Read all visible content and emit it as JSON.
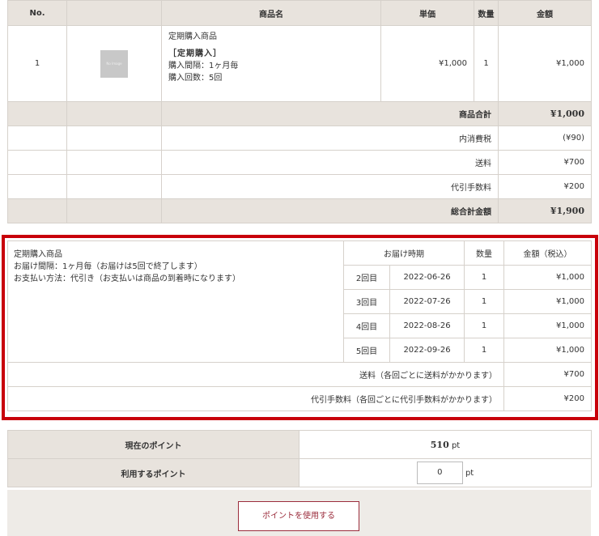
{
  "order": {
    "headers": {
      "no": "No.",
      "blank": "",
      "name": "商品名",
      "unit_price": "単価",
      "qty": "数量",
      "amount": "金額"
    },
    "item": {
      "no": "1",
      "image_text": "No Image",
      "name": "定期購入商品",
      "tag": "［定期購入］",
      "interval": "購入間隔：1ヶ月毎",
      "count": "購入回数：5回",
      "unit_price": "¥1,000",
      "qty": "1",
      "amount": "¥1,000"
    },
    "subtotal": {
      "label": "商品合計",
      "value": "¥1,000"
    },
    "tax": {
      "label": "内消費税",
      "value": "(¥90)"
    },
    "shipping": {
      "label": "送料",
      "value": "¥700"
    },
    "cod": {
      "label": "代引手数料",
      "value": "¥200"
    },
    "total": {
      "label": "総合計金額",
      "value": "¥1,900"
    }
  },
  "subscription": {
    "info_line1": "定期購入商品",
    "info_line2": "お届け間隔：1ヶ月毎（お届けは5回で終了します）",
    "info_line3": "お支払い方法：代引き（お支払いは商品の到着時になります）",
    "headers": {
      "delivery": "お届け時期",
      "qty": "数量",
      "amount": "金額（税込）"
    },
    "rows": [
      {
        "nth": "2回目",
        "date": "2022-06-26",
        "qty": "1",
        "amount": "¥1,000"
      },
      {
        "nth": "3回目",
        "date": "2022-07-26",
        "qty": "1",
        "amount": "¥1,000"
      },
      {
        "nth": "4回目",
        "date": "2022-08-26",
        "qty": "1",
        "amount": "¥1,000"
      },
      {
        "nth": "5回目",
        "date": "2022-09-26",
        "qty": "1",
        "amount": "¥1,000"
      }
    ],
    "shipping": {
      "label": "送料（各回ごとに送料がかかります）",
      "value": "¥700"
    },
    "cod": {
      "label": "代引手数料（各回ごとに代引手数料がかかります）",
      "value": "¥200"
    },
    "highlight_color": "#c8000a"
  },
  "points": {
    "current_label": "現在のポイント",
    "current_value": "510",
    "unit": "pt",
    "use_label": "利用するポイント",
    "use_value": "0",
    "use_unit": "pt"
  },
  "use_button": "ポイントを使用する"
}
